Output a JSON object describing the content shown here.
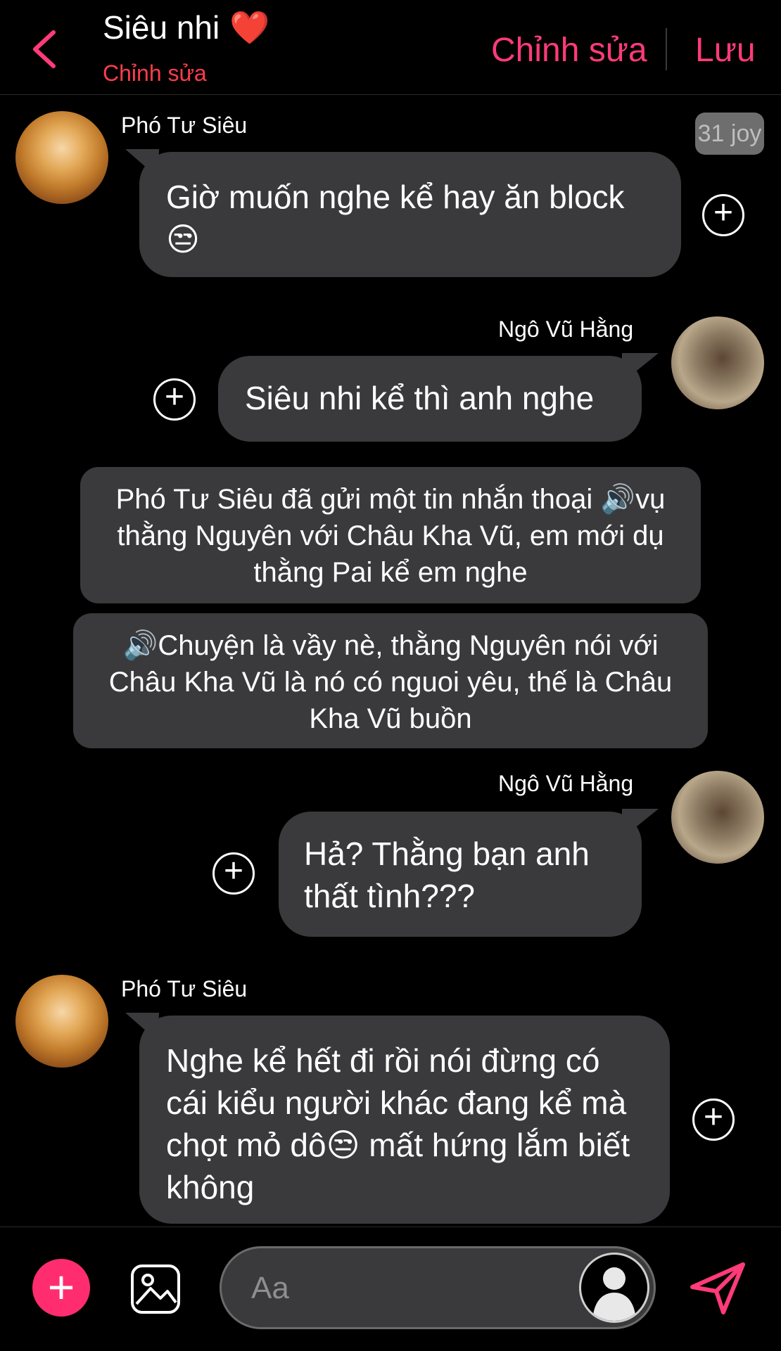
{
  "header": {
    "title": "Siêu nhi",
    "title_emoji": "❤️",
    "subtitle": "Chỉnh sửa",
    "edit_label": "Chỉnh sửa",
    "save_label": "Lưu"
  },
  "timestamp_chip": "31 joy",
  "messages": [
    {
      "sender": "Phó Tư Siêu",
      "side": "left",
      "text": "Giờ muốn nghe kể hay ăn block 😒"
    },
    {
      "sender": "Ngô Vũ Hằng",
      "side": "right",
      "text": "Siêu nhi kể thì anh nghe"
    },
    {
      "type": "narration",
      "text": "Phó Tư Siêu đã gửi một tin nhắn thoại 🔊vụ thằng Nguyên với Châu Kha Vũ, em mới dụ thằng Pai kể em nghe"
    },
    {
      "type": "narration",
      "text": "🔊Chuyện là vầy nè, thằng Nguyên nói với Châu Kha Vũ là nó có nguoi yêu, thế là Châu Kha Vũ buồn"
    },
    {
      "sender": "Ngô Vũ Hằng",
      "side": "right",
      "text": "Hả? Thằng bạn anh thất tình???"
    },
    {
      "sender": "Phó Tư Siêu",
      "side": "left",
      "text": "Nghe kể hết đi rồi nói đừng có cái kiểu người khác đang kể mà chọt mỏ dô😒 mất hứng lắm biết không"
    }
  ],
  "composer": {
    "placeholder": "Aa"
  },
  "icons": {
    "back": "chevron-left-icon",
    "add": "plus-icon",
    "image": "image-icon",
    "send": "send-icon",
    "reaction": "plus-circle-icon"
  },
  "colors": {
    "accent": "#ff3b79",
    "subtitle": "#ff3b4f",
    "bubble": "#3a3a3c",
    "background": "#000000"
  }
}
